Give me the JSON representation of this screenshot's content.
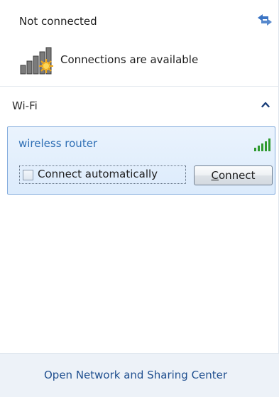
{
  "header": {
    "status": "Not connected",
    "connections_text": "Connections are available"
  },
  "section": {
    "label": "Wi-Fi"
  },
  "network": {
    "name": "wireless router",
    "connect_automatically_label": "Connect automatically",
    "connect_automatically_checked": false,
    "connect_button_label": "Connect",
    "connect_button_mnemonic": "C",
    "connect_button_rest": "onnect"
  },
  "footer": {
    "link_label": "Open Network and Sharing Center"
  },
  "icons": {
    "refresh": "refresh-icon",
    "connections": "network-connections-icon",
    "collapse": "chevron-up-icon",
    "signal": "signal-strength-icon"
  },
  "colors": {
    "network_name": "#2f6fb5",
    "selection_border": "#84acdd",
    "footer_bg": "#edf2f8",
    "link": "#1f4f8f",
    "signal_green": "#2f9a2f"
  }
}
